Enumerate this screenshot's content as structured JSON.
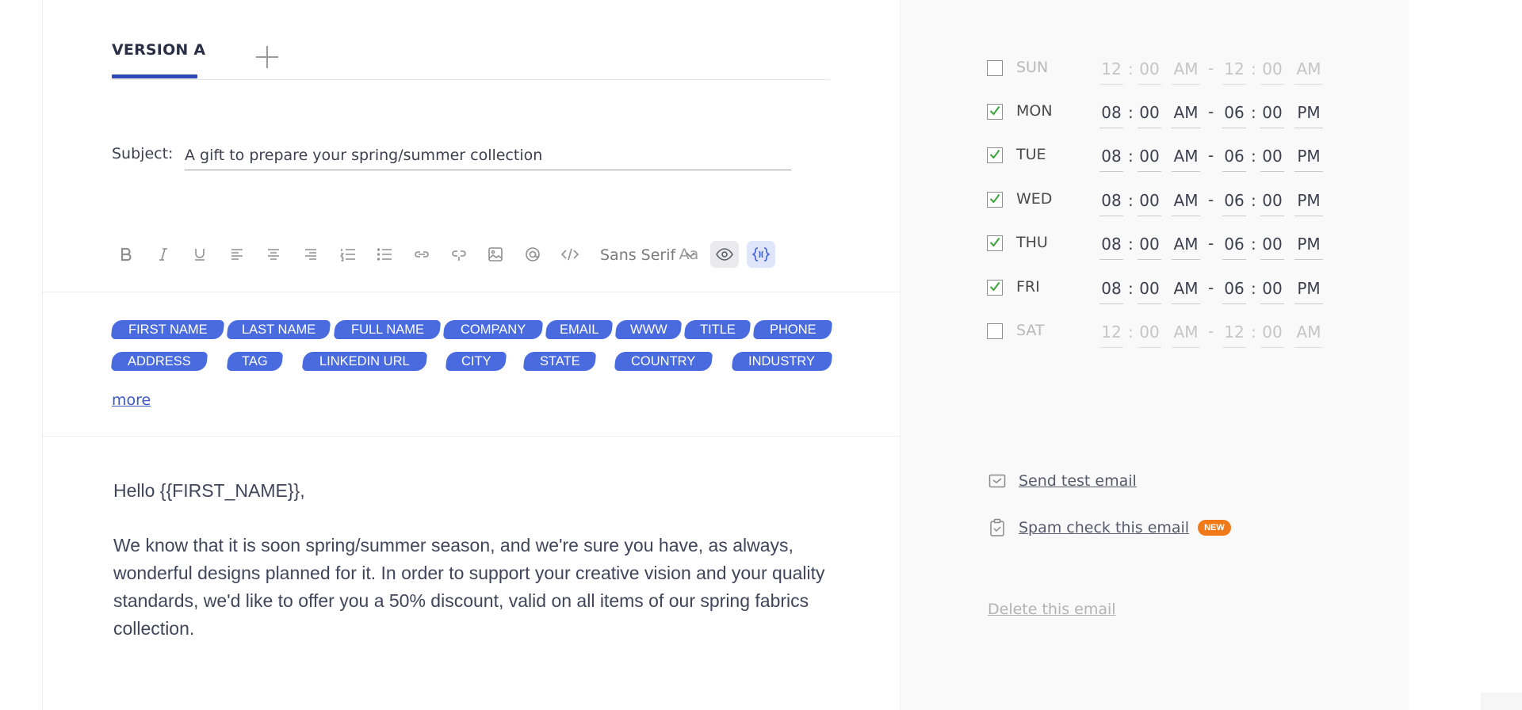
{
  "editor": {
    "tabs": [
      {
        "label": "VERSION A"
      }
    ],
    "subject": {
      "label": "Subject:",
      "value": "A gift to prepare your spring/summer collection"
    },
    "toolbar": {
      "font": "Sans Serif",
      "font_size_label": "Aa"
    },
    "variables": [
      "FIRST NAME",
      "LAST NAME",
      "FULL NAME",
      "COMPANY",
      "EMAIL",
      "WWW",
      "TITLE",
      "PHONE",
      "ADDRESS",
      "TAG",
      "LINKEDIN URL",
      "CITY",
      "STATE",
      "COUNTRY",
      "INDUSTRY"
    ],
    "more_label": "more",
    "body": {
      "greeting": "Hello {{FIRST_NAME}},",
      "paragraph": "We know that it is soon spring/summer season, and we're sure you have, as always, wonderful designs planned for it. In order to support your creative vision and your quality standards, we'd like to offer you a 50% discount, valid on all items of our spring fabrics collection."
    }
  },
  "schedule": [
    {
      "day": "SUN",
      "enabled": false,
      "start_h": "12",
      "start_m": "00",
      "start_p": "AM",
      "end_h": "12",
      "end_m": "00",
      "end_p": "AM"
    },
    {
      "day": "MON",
      "enabled": true,
      "start_h": "08",
      "start_m": "00",
      "start_p": "AM",
      "end_h": "06",
      "end_m": "00",
      "end_p": "PM"
    },
    {
      "day": "TUE",
      "enabled": true,
      "start_h": "08",
      "start_m": "00",
      "start_p": "AM",
      "end_h": "06",
      "end_m": "00",
      "end_p": "PM"
    },
    {
      "day": "WED",
      "enabled": true,
      "start_h": "08",
      "start_m": "00",
      "start_p": "AM",
      "end_h": "06",
      "end_m": "00",
      "end_p": "PM"
    },
    {
      "day": "THU",
      "enabled": true,
      "start_h": "08",
      "start_m": "00",
      "start_p": "AM",
      "end_h": "06",
      "end_m": "00",
      "end_p": "PM"
    },
    {
      "day": "FRI",
      "enabled": true,
      "start_h": "08",
      "start_m": "00",
      "start_p": "AM",
      "end_h": "06",
      "end_m": "00",
      "end_p": "PM"
    },
    {
      "day": "SAT",
      "enabled": false,
      "start_h": "12",
      "start_m": "00",
      "start_p": "AM",
      "end_h": "12",
      "end_m": "00",
      "end_p": "AM"
    }
  ],
  "actions": {
    "send_test": "Send test email",
    "spam_check": "Spam check this email",
    "new_badge": "NEW",
    "delete": "Delete this email"
  },
  "colors": {
    "accent": "#2f49b4",
    "chip": "#4a6ae0",
    "badge": "#f07a1a",
    "check": "#3aa63a"
  }
}
